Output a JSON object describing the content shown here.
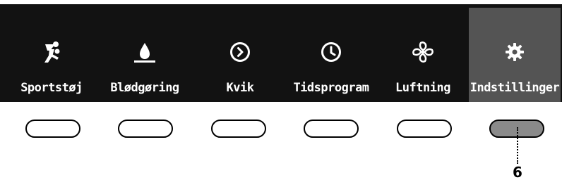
{
  "menu": {
    "items": [
      {
        "label": "Sportstøj",
        "icon": "running-person-icon"
      },
      {
        "label": "Blødgøring",
        "icon": "water-drop-icon"
      },
      {
        "label": "Kvik",
        "icon": "quick-play-icon"
      },
      {
        "label": "Tidsprogram",
        "icon": "clock-icon"
      },
      {
        "label": "Luftning",
        "icon": "fan-icon"
      },
      {
        "label": "Indstillinger",
        "icon": "gear-icon",
        "selected": true
      }
    ]
  },
  "callout": {
    "number": "6"
  },
  "colors": {
    "panel_background": "#121212",
    "selected_background": "#545454",
    "active_button_fill": "#8a8a8a"
  }
}
